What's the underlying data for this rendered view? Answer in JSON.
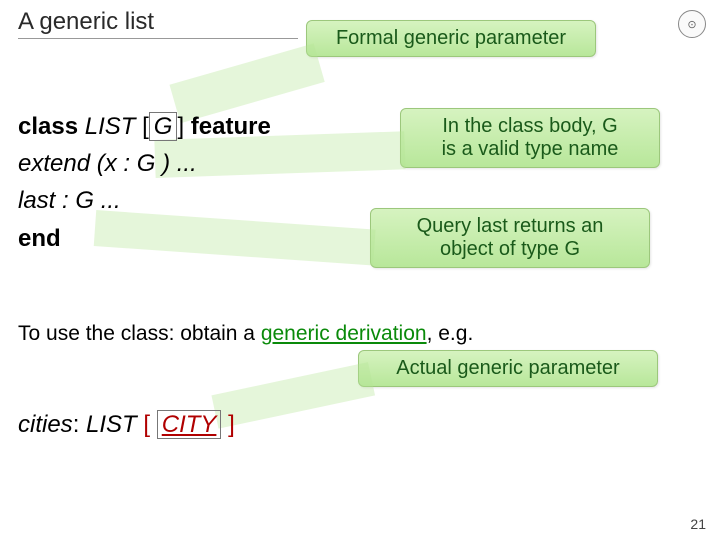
{
  "title": "A generic list",
  "callouts": {
    "formal": "Formal generic parameter",
    "valid": "In the class body, G\nis a valid type name",
    "query": "Query last returns an\nobject of type G",
    "actual": "Actual generic parameter"
  },
  "code": {
    "l1_class": "class",
    "l1_list": "LIST",
    "l1_lb": "[",
    "l1_G": "G",
    "l1_rb": "]",
    "l1_feature": "feature",
    "l2_extend": "extend",
    "l2_rest": "(x : G )  ...",
    "l3_last": "last",
    "l3_rest": ": G  ...",
    "l4_end": "end"
  },
  "use_text": {
    "pre": "To use the class: obtain a ",
    "mid": "generic derivation",
    "post": ", e.g."
  },
  "cities": {
    "c1": "cities",
    "c2": ": ",
    "c3": "LIST ",
    "c4": "[",
    "c5": "CITY",
    "c6": "]"
  },
  "page": "21"
}
